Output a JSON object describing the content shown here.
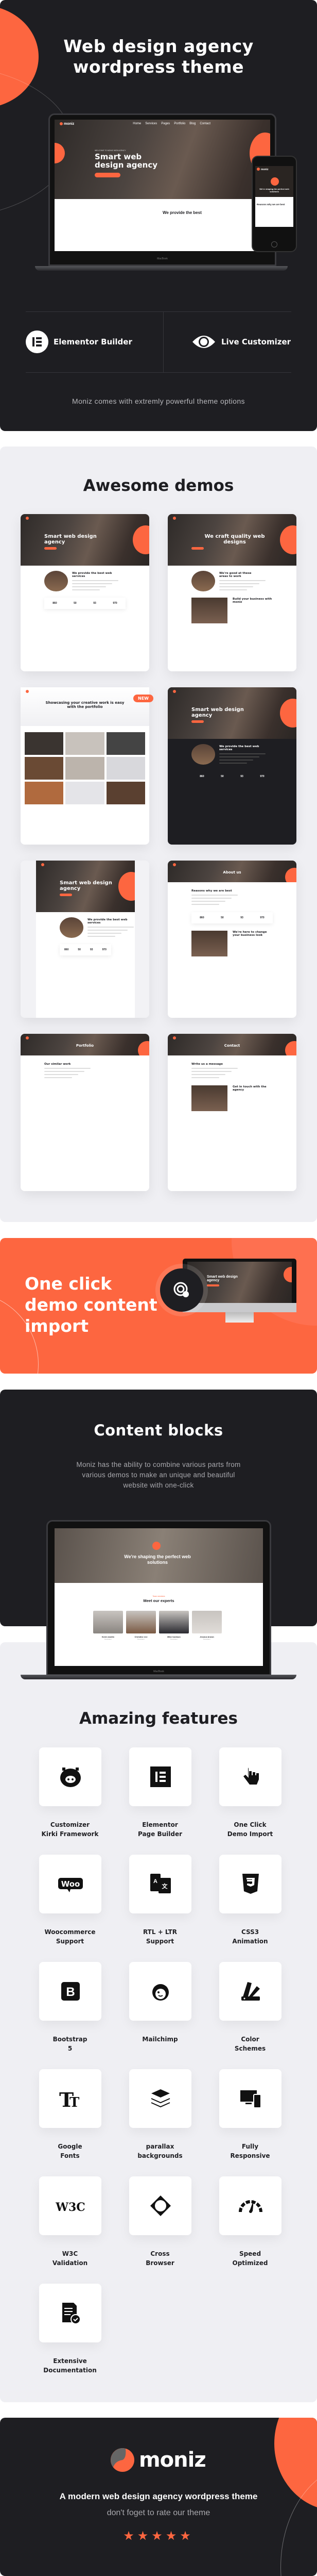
{
  "colors": {
    "accent": "#fd6640",
    "dark": "#1e1e22",
    "light": "#efeff3"
  },
  "hero": {
    "title_line1": "Web design agency",
    "title_line2": "wordpress theme",
    "mockup": {
      "logo": "moniz",
      "nav": [
        "Home",
        "Services",
        "Pages",
        "Portfolio",
        "Blog",
        "Contact"
      ],
      "headline": "Smart web design agency",
      "kicker": "WELCOME TO MONIZ WEB AGENCY",
      "section_title": "We provide the best",
      "device_label": "MacBook",
      "phone": {
        "logo": "moniz",
        "headline": "We're shaping the perfect web solutions",
        "section": "Reasons why we are best"
      }
    },
    "features": [
      {
        "icon": "elementor-icon",
        "label": "Elementor Builder"
      },
      {
        "icon": "eye-icon",
        "label": "Live Customizer"
      }
    ],
    "subtitle": "Moniz comes with extremly powerful theme options"
  },
  "demos": {
    "title": "Awesome demos",
    "items": [
      {
        "variant": "light",
        "hero": "Smart web design agency",
        "section": "We provide the best web services",
        "stats": [
          "860",
          "50",
          "93",
          "970"
        ]
      },
      {
        "variant": "light",
        "hero": "We craft quality web designs",
        "section": "We're good at these areas to work",
        "section2": "Build your business with moniz"
      },
      {
        "variant": "portfolio",
        "hero": "Showcasing your creative work is easy with the portfolio",
        "badge": "NEW"
      },
      {
        "variant": "dark",
        "hero": "Smart web design agency",
        "section": "We provide the best web services",
        "stats": [
          "860",
          "50",
          "93",
          "970"
        ]
      },
      {
        "variant": "boxed",
        "hero": "Smart web design agency",
        "section": "We provide the best web services",
        "stats": [
          "860",
          "50",
          "93",
          "970"
        ]
      },
      {
        "variant": "page",
        "hero": "About us",
        "section": "Reasons why we are best",
        "stats": [
          "860",
          "50",
          "93",
          "970"
        ],
        "section2": "We're here to change your business look"
      },
      {
        "variant": "page",
        "hero": "Portfolio",
        "section": "Our similar work"
      },
      {
        "variant": "page",
        "hero": "Contact",
        "section": "Write us a message",
        "section2": "Get in touch with the agency"
      }
    ]
  },
  "import_banner": {
    "line1": "One click",
    "line2": "demo content",
    "line3": "import",
    "icon": "click-icon",
    "mockup_headline": "Smart web design agency"
  },
  "content_blocks": {
    "title": "Content blocks",
    "desc_line1": "Moniz has the ability to combine various parts from",
    "desc_line2": "various demos to make an unique and beautiful",
    "desc_line3": "website with one-click",
    "mockup": {
      "headline": "We're shaping the perfect web solutions",
      "team_kicker": "Team members",
      "team_title": "Meet our experts",
      "device_label": "MacBook",
      "team": [
        {
          "name": "Kevin martin",
          "role": "Developer"
        },
        {
          "name": "Christine eve",
          "role": "Developer"
        },
        {
          "name": "Mike hardson",
          "role": "Developer"
        },
        {
          "name": "Jessica brown",
          "role": "Developer"
        }
      ]
    }
  },
  "features": {
    "title": "Amazing features",
    "items": [
      {
        "icon": "kirki-pig-icon",
        "label": "Customizer\nKirki Framework"
      },
      {
        "icon": "elementor-icon",
        "label": "Elementor\nPage Builder"
      },
      {
        "icon": "hand-pointer-icon",
        "label": "One Click\nDemo Import"
      },
      {
        "icon": "woocommerce-icon",
        "label": "Woocommerce\nSupport"
      },
      {
        "icon": "translate-icon",
        "label": "RTL + LTR\nSupport"
      },
      {
        "icon": "css3-icon",
        "label": "CSS3\nAnimation"
      },
      {
        "icon": "bootstrap-icon",
        "label": "Bootstrap\n5"
      },
      {
        "icon": "mailchimp-icon",
        "label": "Mailchimp"
      },
      {
        "icon": "color-swatch-icon",
        "label": "Color\nSchemes"
      },
      {
        "icon": "font-icon",
        "label": "Google\nFonts"
      },
      {
        "icon": "layers-icon",
        "label": "parallax\nbackgrounds"
      },
      {
        "icon": "devices-icon",
        "label": "Fully\nResponsive"
      },
      {
        "icon": "w3c-icon",
        "label": "W3C\nValidation"
      },
      {
        "icon": "cross-browser-icon",
        "label": "Cross\nBrowser"
      },
      {
        "icon": "speedometer-icon",
        "label": "Speed\nOptimized"
      },
      {
        "icon": "document-check-icon",
        "label": "Extensive\nDocumentation"
      }
    ]
  },
  "footer": {
    "logo": "moniz",
    "tagline": "A modern web design agency wordpress theme",
    "subtitle": "don't foget to rate our theme",
    "rating": 5,
    "rating_max": 5
  }
}
